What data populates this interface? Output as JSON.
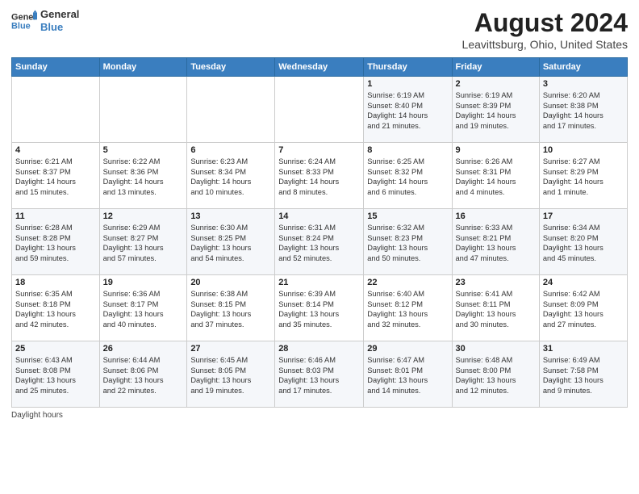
{
  "header": {
    "logo_line1": "General",
    "logo_line2": "Blue",
    "title": "August 2024",
    "subtitle": "Leavittsburg, Ohio, United States"
  },
  "weekdays": [
    "Sunday",
    "Monday",
    "Tuesday",
    "Wednesday",
    "Thursday",
    "Friday",
    "Saturday"
  ],
  "weeks": [
    [
      {
        "day": "",
        "info": ""
      },
      {
        "day": "",
        "info": ""
      },
      {
        "day": "",
        "info": ""
      },
      {
        "day": "",
        "info": ""
      },
      {
        "day": "1",
        "info": "Sunrise: 6:19 AM\nSunset: 8:40 PM\nDaylight: 14 hours\nand 21 minutes."
      },
      {
        "day": "2",
        "info": "Sunrise: 6:19 AM\nSunset: 8:39 PM\nDaylight: 14 hours\nand 19 minutes."
      },
      {
        "day": "3",
        "info": "Sunrise: 6:20 AM\nSunset: 8:38 PM\nDaylight: 14 hours\nand 17 minutes."
      }
    ],
    [
      {
        "day": "4",
        "info": "Sunrise: 6:21 AM\nSunset: 8:37 PM\nDaylight: 14 hours\nand 15 minutes."
      },
      {
        "day": "5",
        "info": "Sunrise: 6:22 AM\nSunset: 8:36 PM\nDaylight: 14 hours\nand 13 minutes."
      },
      {
        "day": "6",
        "info": "Sunrise: 6:23 AM\nSunset: 8:34 PM\nDaylight: 14 hours\nand 10 minutes."
      },
      {
        "day": "7",
        "info": "Sunrise: 6:24 AM\nSunset: 8:33 PM\nDaylight: 14 hours\nand 8 minutes."
      },
      {
        "day": "8",
        "info": "Sunrise: 6:25 AM\nSunset: 8:32 PM\nDaylight: 14 hours\nand 6 minutes."
      },
      {
        "day": "9",
        "info": "Sunrise: 6:26 AM\nSunset: 8:31 PM\nDaylight: 14 hours\nand 4 minutes."
      },
      {
        "day": "10",
        "info": "Sunrise: 6:27 AM\nSunset: 8:29 PM\nDaylight: 14 hours\nand 1 minute."
      }
    ],
    [
      {
        "day": "11",
        "info": "Sunrise: 6:28 AM\nSunset: 8:28 PM\nDaylight: 13 hours\nand 59 minutes."
      },
      {
        "day": "12",
        "info": "Sunrise: 6:29 AM\nSunset: 8:27 PM\nDaylight: 13 hours\nand 57 minutes."
      },
      {
        "day": "13",
        "info": "Sunrise: 6:30 AM\nSunset: 8:25 PM\nDaylight: 13 hours\nand 54 minutes."
      },
      {
        "day": "14",
        "info": "Sunrise: 6:31 AM\nSunset: 8:24 PM\nDaylight: 13 hours\nand 52 minutes."
      },
      {
        "day": "15",
        "info": "Sunrise: 6:32 AM\nSunset: 8:23 PM\nDaylight: 13 hours\nand 50 minutes."
      },
      {
        "day": "16",
        "info": "Sunrise: 6:33 AM\nSunset: 8:21 PM\nDaylight: 13 hours\nand 47 minutes."
      },
      {
        "day": "17",
        "info": "Sunrise: 6:34 AM\nSunset: 8:20 PM\nDaylight: 13 hours\nand 45 minutes."
      }
    ],
    [
      {
        "day": "18",
        "info": "Sunrise: 6:35 AM\nSunset: 8:18 PM\nDaylight: 13 hours\nand 42 minutes."
      },
      {
        "day": "19",
        "info": "Sunrise: 6:36 AM\nSunset: 8:17 PM\nDaylight: 13 hours\nand 40 minutes."
      },
      {
        "day": "20",
        "info": "Sunrise: 6:38 AM\nSunset: 8:15 PM\nDaylight: 13 hours\nand 37 minutes."
      },
      {
        "day": "21",
        "info": "Sunrise: 6:39 AM\nSunset: 8:14 PM\nDaylight: 13 hours\nand 35 minutes."
      },
      {
        "day": "22",
        "info": "Sunrise: 6:40 AM\nSunset: 8:12 PM\nDaylight: 13 hours\nand 32 minutes."
      },
      {
        "day": "23",
        "info": "Sunrise: 6:41 AM\nSunset: 8:11 PM\nDaylight: 13 hours\nand 30 minutes."
      },
      {
        "day": "24",
        "info": "Sunrise: 6:42 AM\nSunset: 8:09 PM\nDaylight: 13 hours\nand 27 minutes."
      }
    ],
    [
      {
        "day": "25",
        "info": "Sunrise: 6:43 AM\nSunset: 8:08 PM\nDaylight: 13 hours\nand 25 minutes."
      },
      {
        "day": "26",
        "info": "Sunrise: 6:44 AM\nSunset: 8:06 PM\nDaylight: 13 hours\nand 22 minutes."
      },
      {
        "day": "27",
        "info": "Sunrise: 6:45 AM\nSunset: 8:05 PM\nDaylight: 13 hours\nand 19 minutes."
      },
      {
        "day": "28",
        "info": "Sunrise: 6:46 AM\nSunset: 8:03 PM\nDaylight: 13 hours\nand 17 minutes."
      },
      {
        "day": "29",
        "info": "Sunrise: 6:47 AM\nSunset: 8:01 PM\nDaylight: 13 hours\nand 14 minutes."
      },
      {
        "day": "30",
        "info": "Sunrise: 6:48 AM\nSunset: 8:00 PM\nDaylight: 13 hours\nand 12 minutes."
      },
      {
        "day": "31",
        "info": "Sunrise: 6:49 AM\nSunset: 7:58 PM\nDaylight: 13 hours\nand 9 minutes."
      }
    ]
  ],
  "footer": {
    "label": "Daylight hours"
  }
}
